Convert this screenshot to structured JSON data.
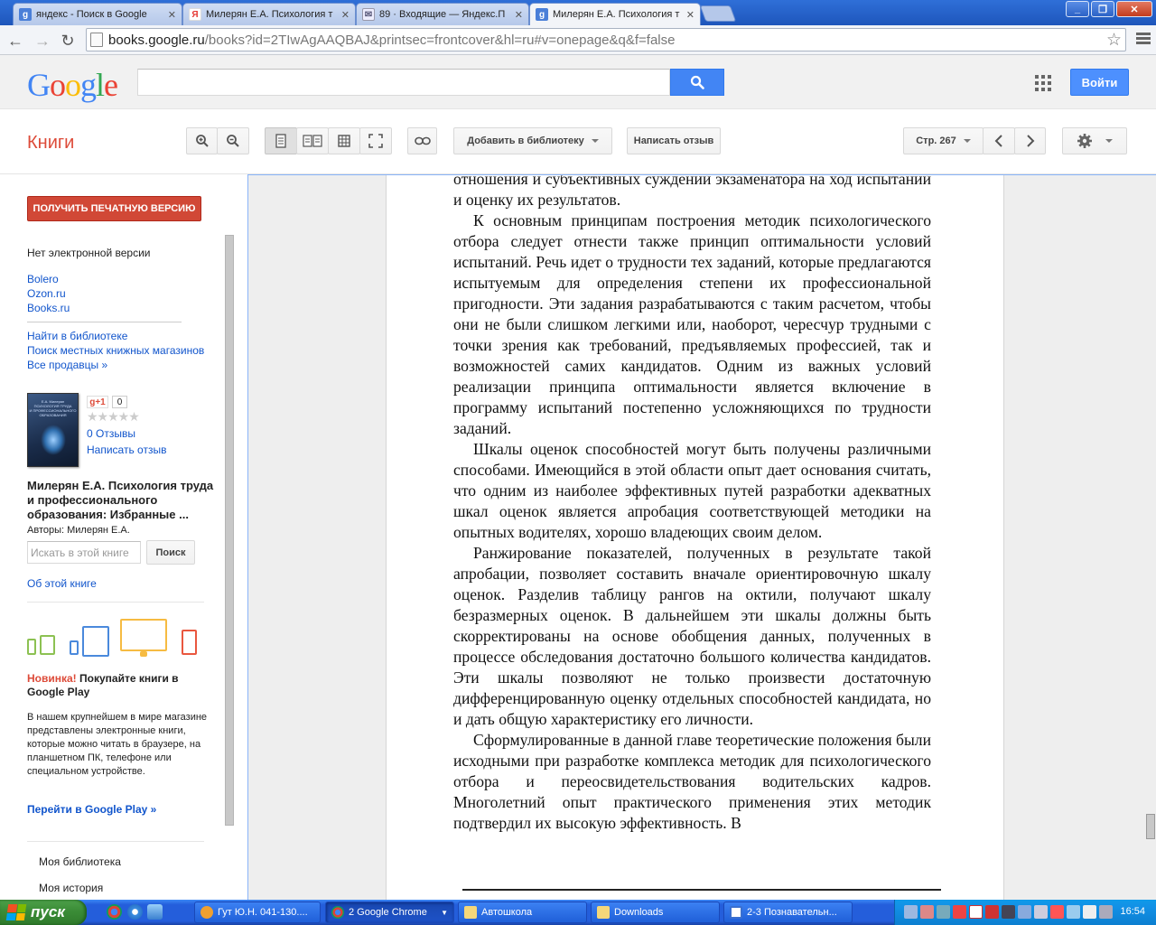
{
  "browser": {
    "tabs": [
      {
        "label": "яндекс - Поиск в Google",
        "icon": "google-favicon",
        "color": "#4a7fd8"
      },
      {
        "label": "Милерян Е.А. Психология т",
        "icon": "yandex-favicon",
        "color": "#e53935"
      },
      {
        "label": "89 · Входящие — Яндекс.П",
        "icon": "mail-favicon",
        "color": "#6a8cc8"
      },
      {
        "label": "Милерян Е.А. Психология т",
        "icon": "google-favicon",
        "color": "#4a7fd8"
      }
    ],
    "url_host": "books.google.ru",
    "url_path": "/books?id=2TIwAgAAQBAJ&printsec=frontcover&hl=ru#v=onepage&q&f=false",
    "window_controls": [
      "_",
      "❐",
      "✕"
    ]
  },
  "google_header": {
    "logo": [
      "G",
      "o",
      "o",
      "g",
      "l",
      "e"
    ],
    "logo_colors": [
      "#4285f4",
      "#ea4335",
      "#fbbc05",
      "#4285f4",
      "#34a853",
      "#ea4335"
    ],
    "login": "Войти"
  },
  "toolbar": {
    "books_title": "Книги",
    "add_to_library": "Добавить в библиотеку",
    "write_review": "Написать отзыв",
    "page_select": "Стр. 267"
  },
  "sidebar": {
    "get_print": "ПОЛУЧИТЬ ПЕЧАТНУЮ ВЕРСИЮ",
    "no_ebook": "Нет электронной версии",
    "sellers": [
      "Bolero",
      "Ozon.ru",
      "Books.ru"
    ],
    "find_in_library": "Найти в библиотеке",
    "local_stores": "Поиск местных книжных магазинов",
    "all_sellers": "Все продавцы »",
    "gplus": "g+1",
    "gplus_count": "0",
    "reviews_count": "0 Отзывы",
    "write_review": "Написать отзыв",
    "book_title": "Милерян Е.А. Психология труда и профессионального образования: Избранные ...",
    "authors": "Авторы: Милерян Е.А.",
    "search_placeholder": "Искать в этой книге",
    "search_btn": "Поиск",
    "about": "Об этой книге",
    "promo_new": "Новинка!",
    "promo_title": " Покупайте книги в Google Play",
    "promo_desc": "В нашем крупнейшем в мире магазине представлены электронные книги, которые можно читать в браузере, на планшетном ПК, телефоне или специальном устройстве.",
    "promo_link": "Перейти в Google Play »",
    "my_library": "Моя библиотека",
    "my_history": "Моя история"
  },
  "book_page": {
    "paragraphs": [
      {
        "cont": true,
        "text": "отношения и субъективных суждений экзаменатора на ход испытаний и оценку их результатов."
      },
      {
        "cont": false,
        "text": "К основным принципам построения методик психологиче­ского отбора следует отнести также принцип оптимальности условий испытаний. Речь идет о трудности тех заданий, ко­торые предлагаются испытуемым для определения степени их профессиональной пригодности. Эти задания разрабатыва­ются с таким расчетом, чтобы они не были слишком легкими или, наоборот, чересчур трудными с точки зрения как требо­ваний, предъявляемых профессией, так и возможностей са­мих кандидатов. Одним из важных условий реализации прин­ципа оптимальности является включение в программу испы­таний постепенно усложняющихся по трудности заданий."
      },
      {
        "cont": false,
        "text": "Шкалы оценок способностей могут быть получены различ­ными способами. Имеющийся в этой области опыт дает ос­нования считать, что одним из наиболее эффективных путей разработки адекватных шкал оценок является апробация со­ответствующей методики на опытных водителях, хорошо вла­деющих своим делом."
      },
      {
        "cont": false,
        "text": "Ранжирование показателей, полученных в результате та­кой апробации, позволяет составить вначале ориентировоч­ную шкалу оценок. Разделив таблицу рангов на октили, полу­чают шкалу безразмерных оценок. В дальнейшем эти шкалы должны быть скорректированы на основе обобщения данных, полученных в процессе обследования достаточно большого количества кандидатов. Эти шкалы позволяют не только про­извести достаточную дифференцированную оценку отдель­ных способностей кандидата, но и дать общую характеристи­ку его личности."
      },
      {
        "cont": false,
        "text": "Сформулированные в данной главе теоретические положе­ния были исходными при разработке комплекса методик для психологического отбора и переосвидетельствования води­тельских кадров. Многолетний опыт практического примене­ния этих методик подтвердил их высокую эффективность. В"
      }
    ]
  },
  "taskbar": {
    "start": "пуск",
    "tasks": [
      {
        "label": "Гут Ю.Н. 041-130....",
        "icon": "face-icon",
        "color": "#f0a030"
      },
      {
        "label": "2 Google Chrome",
        "icon": "chrome-icon",
        "color": "#e0e0e0"
      },
      {
        "label": "Автошкола",
        "icon": "folder-icon",
        "color": "#f5d77a"
      },
      {
        "label": "Downloads",
        "icon": "folder-icon",
        "color": "#f5d77a"
      },
      {
        "label": "2-3 Познавательн...",
        "icon": "word-icon",
        "color": "#3a6fd0"
      }
    ],
    "clock": "16:54"
  }
}
